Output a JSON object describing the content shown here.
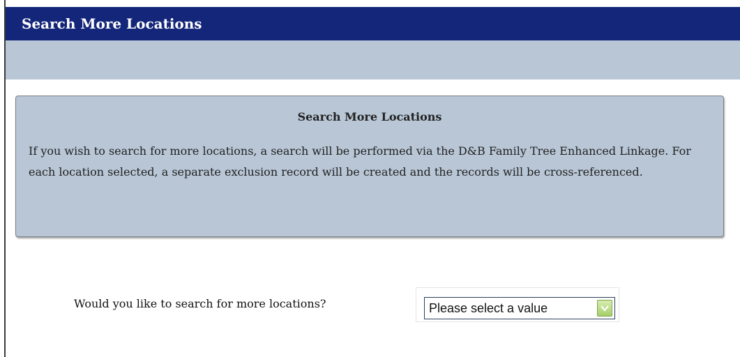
{
  "header": {
    "title": "Search More Locations"
  },
  "info_panel": {
    "heading": "Search More Locations",
    "body": "If you wish to search for more locations, a search will be performed via the D&B Family Tree Enhanced Linkage. For each location selected, a separate exclusion record will be created and the records will be cross-referenced."
  },
  "form": {
    "question": "Would you like to search for more locations?",
    "select": {
      "selected_value": "Please select a value",
      "icon": "chevron-down-icon"
    }
  },
  "colors": {
    "title_bar": "#14267a",
    "panel_background": "#b8c6d6",
    "dropdown_arrow": "#a5cf6a"
  }
}
